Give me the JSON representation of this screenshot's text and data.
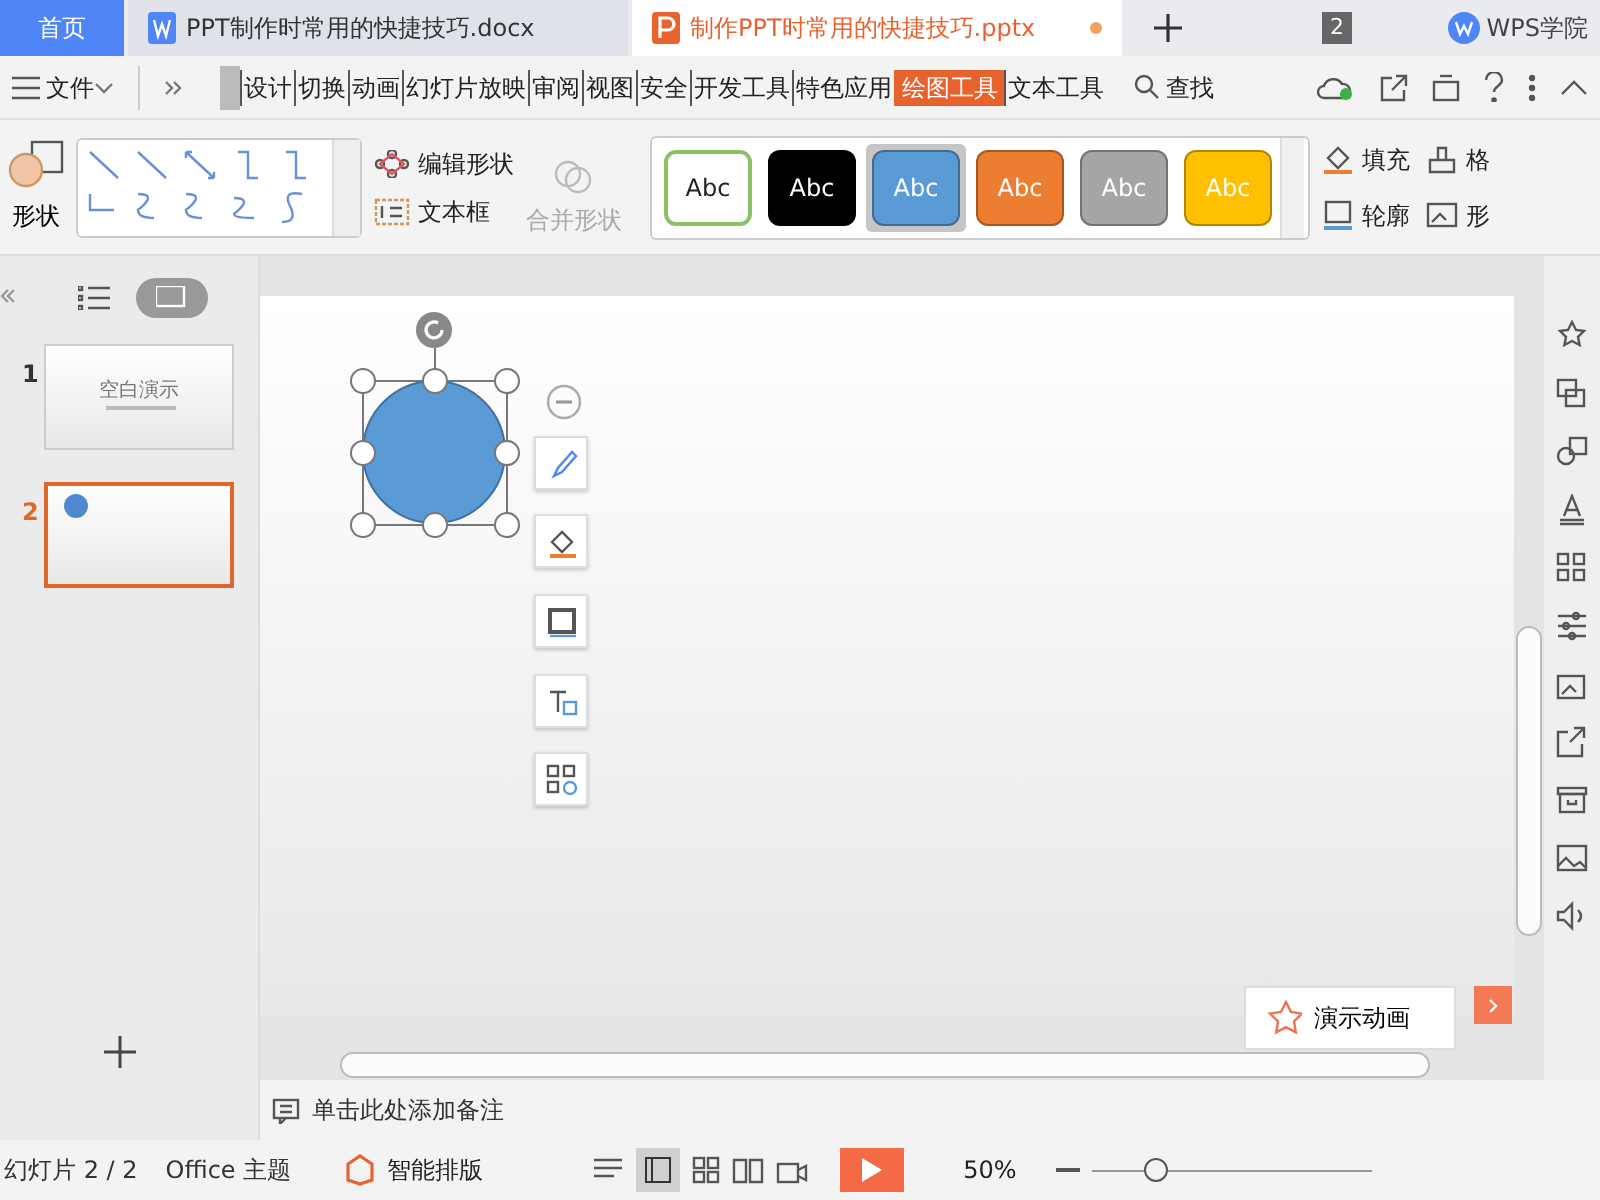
{
  "tabs": [
    {
      "label": "首页",
      "kind": "home",
      "selected": false
    },
    {
      "label": "PPT制作时常用的快捷技巧.docx",
      "kind": "writer",
      "selected": false,
      "unsaved": false
    },
    {
      "label": "制作PPT时常用的快捷技巧.pptx",
      "kind": "presentation",
      "selected": true,
      "unsaved": true
    }
  ],
  "window_count": "2",
  "account": "WPS学院",
  "menu": {
    "file": "文件",
    "ribbon_tabs": [
      {
        "label": "设计",
        "selected": false
      },
      {
        "label": "切换",
        "selected": false
      },
      {
        "label": "动画",
        "selected": false
      },
      {
        "label": "幻灯片放映",
        "selected": false
      },
      {
        "label": "审阅",
        "selected": false
      },
      {
        "label": "视图",
        "selected": false
      },
      {
        "label": "安全",
        "selected": false
      },
      {
        "label": "开发工具",
        "selected": false
      },
      {
        "label": "特色应用",
        "selected": false
      },
      {
        "label": "绘图工具",
        "selected": true
      },
      {
        "label": "文本工具",
        "selected": false
      }
    ],
    "search": "查找"
  },
  "ribbon": {
    "shape_button": "形状",
    "shape_tools": [
      {
        "label": "编辑形状",
        "disabled": false
      },
      {
        "label": "文本框",
        "disabled": false
      },
      {
        "label": "合并形状",
        "disabled": true
      }
    ],
    "style_presets": [
      {
        "label": "Abc",
        "kind": "outline",
        "color": "#ffffff",
        "selected": false
      },
      {
        "label": "Abc",
        "kind": "filled",
        "color": "#000000",
        "selected": false
      },
      {
        "label": "Abc",
        "kind": "filled",
        "color": "#5b9bd5",
        "selected": true
      },
      {
        "label": "Abc",
        "kind": "filled",
        "color": "#ed7d31",
        "selected": false
      },
      {
        "label": "Abc",
        "kind": "filled",
        "color": "#a5a5a5",
        "selected": false
      },
      {
        "label": "Abc",
        "kind": "filled",
        "color": "#ffc000",
        "selected": false
      }
    ],
    "format_tools": [
      {
        "label": "填充"
      },
      {
        "label": "轮廓"
      },
      {
        "label": "格"
      },
      {
        "label": "形"
      }
    ]
  },
  "slides": [
    {
      "number": "1",
      "selected": false,
      "title": "空白演示"
    },
    {
      "number": "2",
      "selected": true
    }
  ],
  "notes": {
    "placeholder": "单击此处添加备注"
  },
  "animation_button": "演示动画",
  "status_bar": {
    "slide": "幻灯片 2 / 2",
    "theme": "Office 主题",
    "smart_layout": "智能排版",
    "zoom": "50%",
    "zoom_slider": {
      "level": 0.2
    }
  }
}
